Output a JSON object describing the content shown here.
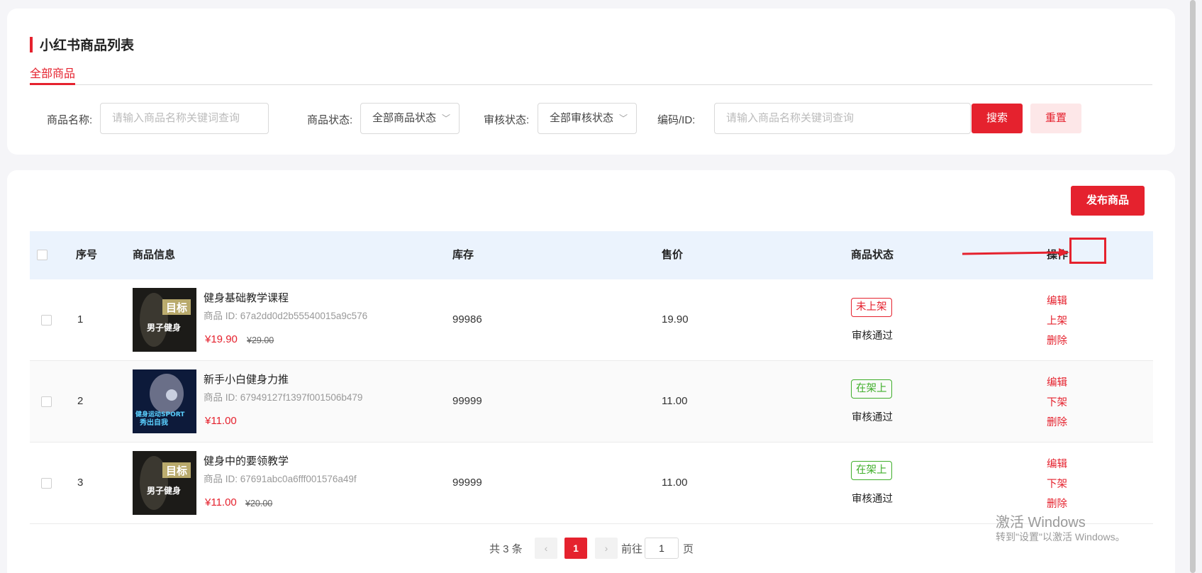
{
  "header": {
    "title": "小红书商品列表",
    "tab": "全部商品"
  },
  "filters": {
    "name_label": "商品名称:",
    "name_placeholder": "请输入商品名称关键词查询",
    "status_label": "商品状态:",
    "status_value": "全部商品状态",
    "audit_label": "审核状态:",
    "audit_value": "全部审核状态",
    "code_label": "编码/ID:",
    "code_placeholder": "请输入商品名称关键词查询",
    "search_button": "搜索",
    "reset_button": "重置"
  },
  "publish_button": "发布商品",
  "table": {
    "columns": {
      "index": "序号",
      "info": "商品信息",
      "stock": "库存",
      "price": "售价",
      "status": "商品状态",
      "ops": "操作"
    },
    "rows": [
      {
        "index": "1",
        "name": "健身基础教学课程",
        "product_id": "商品 ID: 67a2dd0d2b55540015a9c576",
        "price": "¥19.90",
        "original_price": "¥29.00",
        "stock": "99986",
        "sale_price": "19.90",
        "status": "未上架",
        "audit": "审核通过",
        "ops": [
          "编辑",
          "上架",
          "删除"
        ]
      },
      {
        "index": "2",
        "name": "新手小白健身力推",
        "product_id": "商品 ID: 67949127f1397f001506b479",
        "price": "¥11.00",
        "original_price": "",
        "stock": "99999",
        "sale_price": "11.00",
        "status": "在架上",
        "audit": "审核通过",
        "ops": [
          "编辑",
          "下架",
          "删除"
        ]
      },
      {
        "index": "3",
        "name": "健身中的要领教学",
        "product_id": "商品 ID: 67691abc0a6fff001576a49f",
        "price": "¥11.00",
        "original_price": "¥20.00",
        "stock": "99999",
        "sale_price": "11.00",
        "status": "在架上",
        "audit": "审核通过",
        "ops": [
          "编辑",
          "下架",
          "删除"
        ]
      }
    ]
  },
  "thumb_text": {
    "row1_top": "目标",
    "row1_bottom": "男子健身",
    "row2_top": "健身运动SPORT",
    "row2_bottom": "秀出自我",
    "row3_top": "目标",
    "row3_bottom": "男子健身"
  },
  "pagination": {
    "total": "共 3 条",
    "current_page": "1",
    "goto_label": "前往",
    "goto_value": "1",
    "page_suffix": "页",
    "prev_icon": "‹",
    "next_icon": "›"
  },
  "watermark": {
    "title": "激活 Windows",
    "subtitle": "转到\"设置\"以激活 Windows。"
  },
  "colors": {
    "accent": "#e5222e",
    "green": "#3fae2a",
    "header_bg": "#ebf3fd"
  }
}
